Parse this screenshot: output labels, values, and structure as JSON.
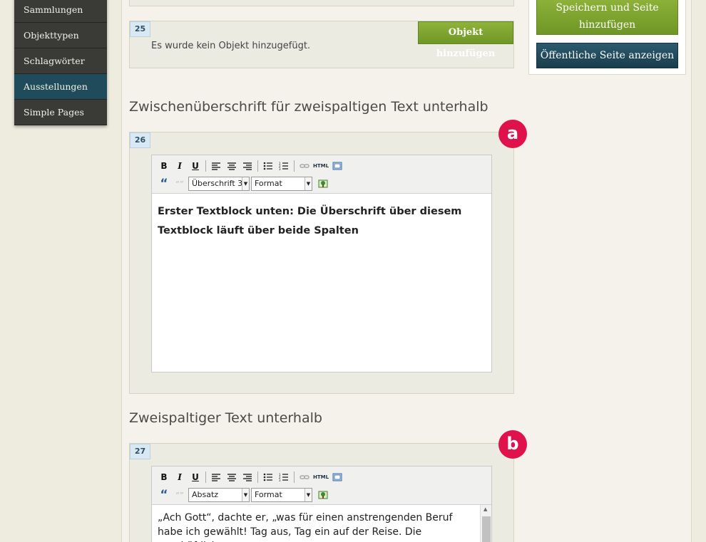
{
  "sidebar": {
    "items": [
      {
        "label": "Sammlungen"
      },
      {
        "label": "Objekttypen"
      },
      {
        "label": "Schlagwörter"
      },
      {
        "label": "Ausstellungen"
      },
      {
        "label": "Simple Pages"
      }
    ]
  },
  "side_panel": {
    "save_label": "Speichern und Seite hinzufügen",
    "view_label": "Öffentliche Seite anzeigen"
  },
  "block25": {
    "number": "25",
    "add_button": "Objekt hinzufügen",
    "message": "Es wurde kein Objekt hinzugefügt."
  },
  "section_a": {
    "heading": "Zwischenüberschrift für zweispaltigen Text unterhalb",
    "number": "26",
    "marker": "a",
    "format_select": "Überschrift 3",
    "style_select": "Format",
    "content": "Erster Textblock unten: Die Überschrift über diesem Textblock läuft über beide Spalten"
  },
  "section_b": {
    "heading": "Zweispaltiger Text unterhalb",
    "number": "27",
    "marker": "b",
    "format_select": "Absatz",
    "style_select": "Format",
    "content": "„Ach Gott“, dachte er, „was für einen anstrengenden Beruf habe ich gewählt! Tag aus, Tag ein auf der Reise. Die geschäftlichen"
  },
  "toolbar": {
    "bold": "B",
    "italic": "I",
    "underline": "U",
    "html": "HTML",
    "quote": "“",
    "unquote": "“”"
  }
}
